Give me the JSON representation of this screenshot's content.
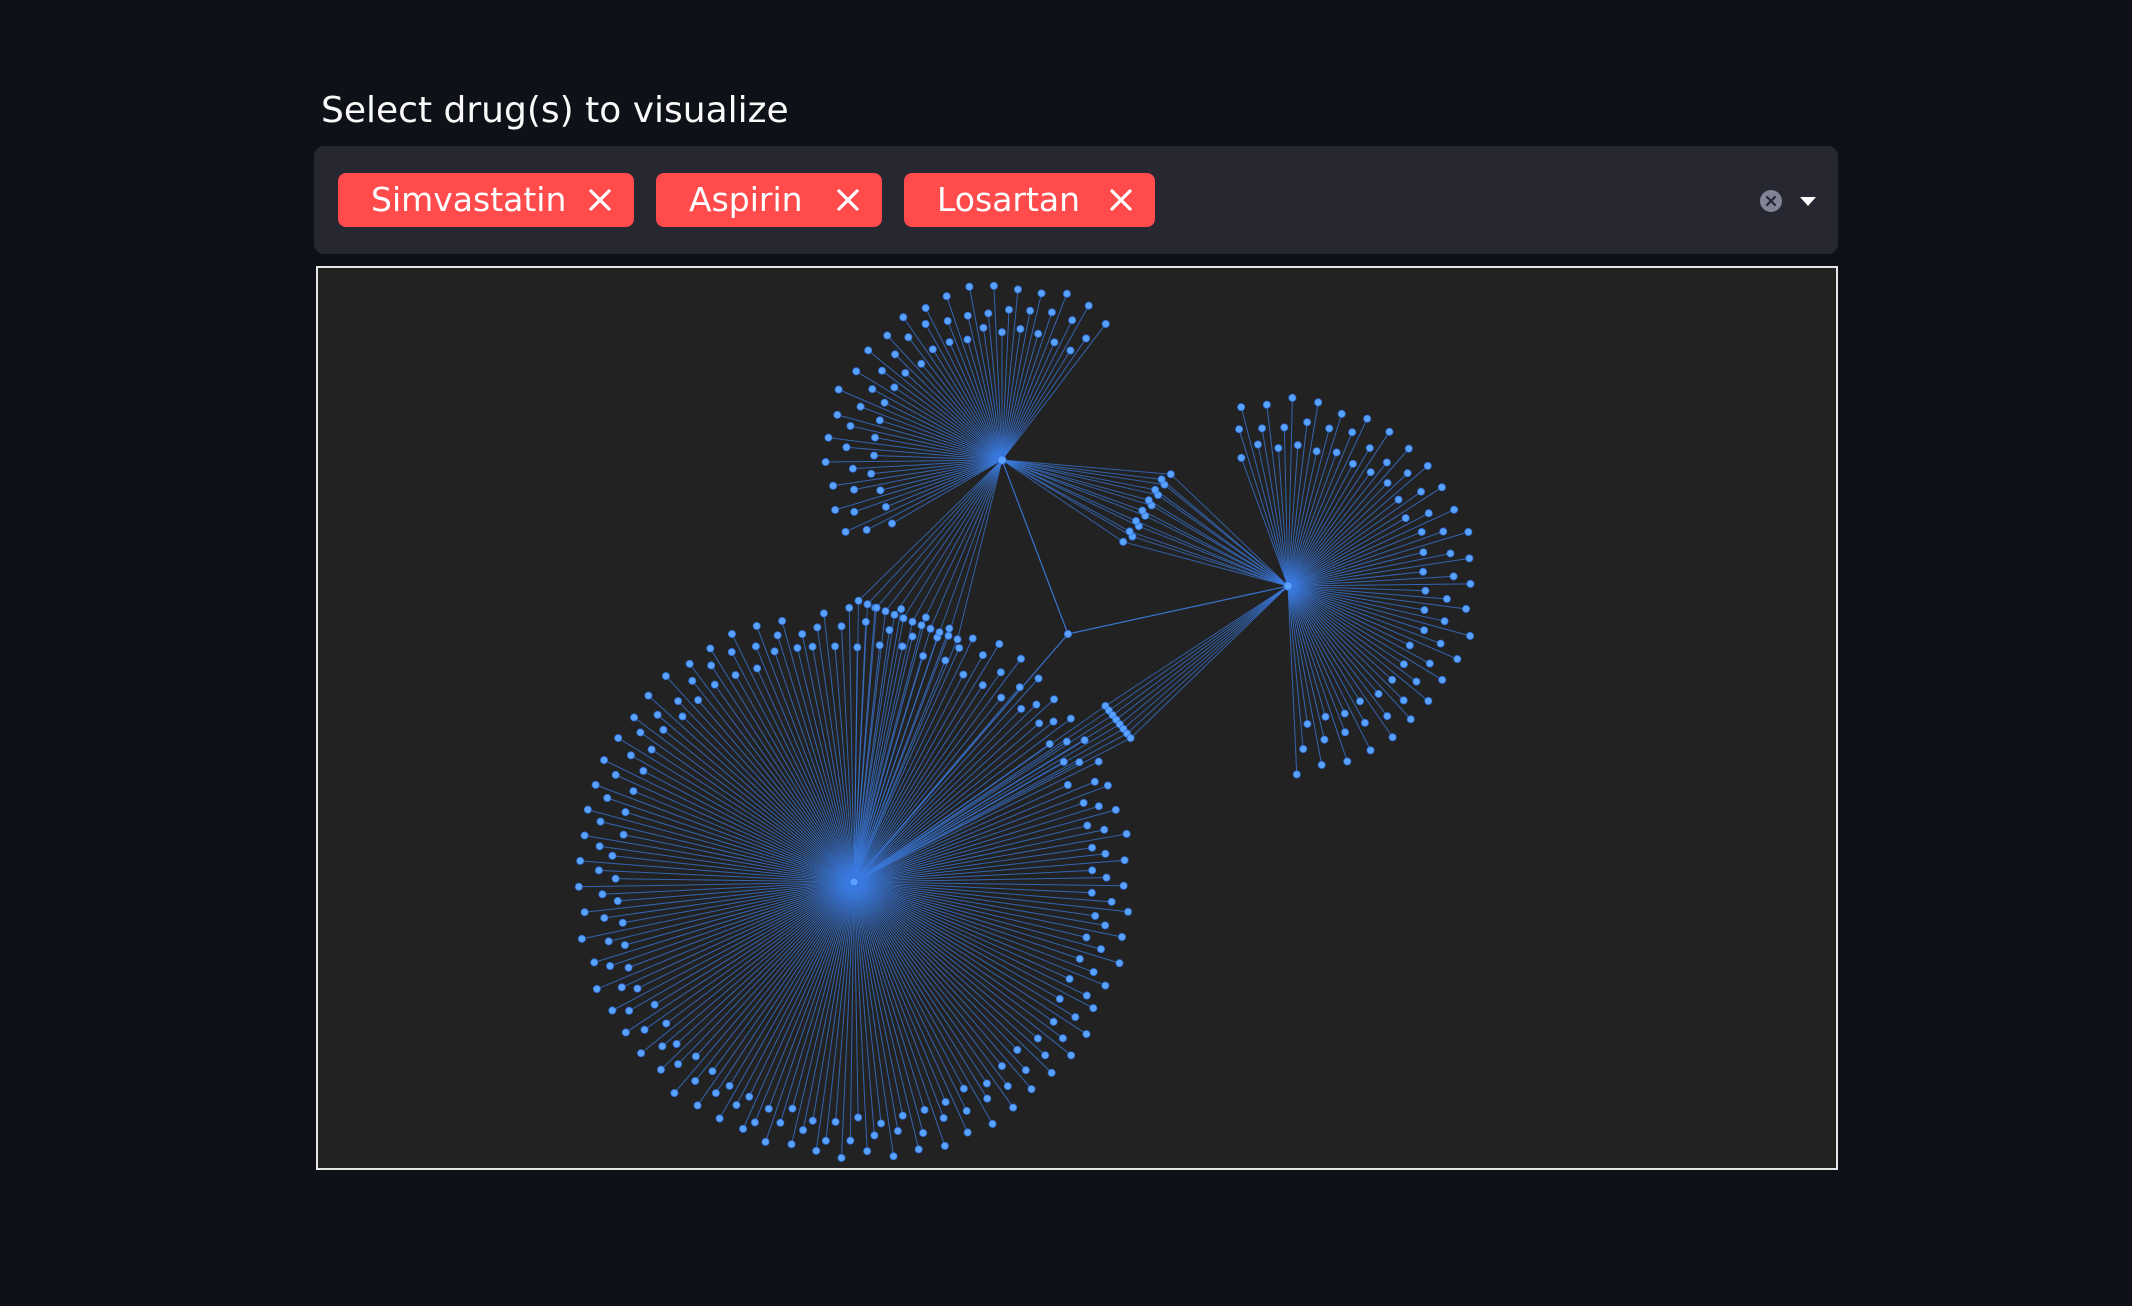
{
  "prompt": {
    "label": "Select drug(s) to visualize"
  },
  "multiselect": {
    "selected": [
      {
        "label": "Simvastatin",
        "remove_icon": "close-icon"
      },
      {
        "label": "Aspirin",
        "remove_icon": "close-icon"
      },
      {
        "label": "Losartan",
        "remove_icon": "close-icon"
      }
    ],
    "clear_icon": "clear-circle-icon",
    "dropdown_icon": "caret-down-icon"
  },
  "graph": {
    "node_color": "#5aa2ff",
    "edge_color": "#3b7be0",
    "background": "#222222",
    "clusters": [
      {
        "name": "hub-large",
        "leaf_count": 200
      },
      {
        "name": "hub-top",
        "leaf_count": 60
      },
      {
        "name": "hub-right",
        "leaf_count": 75
      }
    ],
    "shared_groups": [
      {
        "between": "hub-top + hub-large",
        "count": 12
      },
      {
        "between": "hub-top + hub-right",
        "count": 14
      },
      {
        "between": "hub-large + hub-right",
        "count": 8
      },
      {
        "between": "all three",
        "count": 1
      }
    ]
  }
}
